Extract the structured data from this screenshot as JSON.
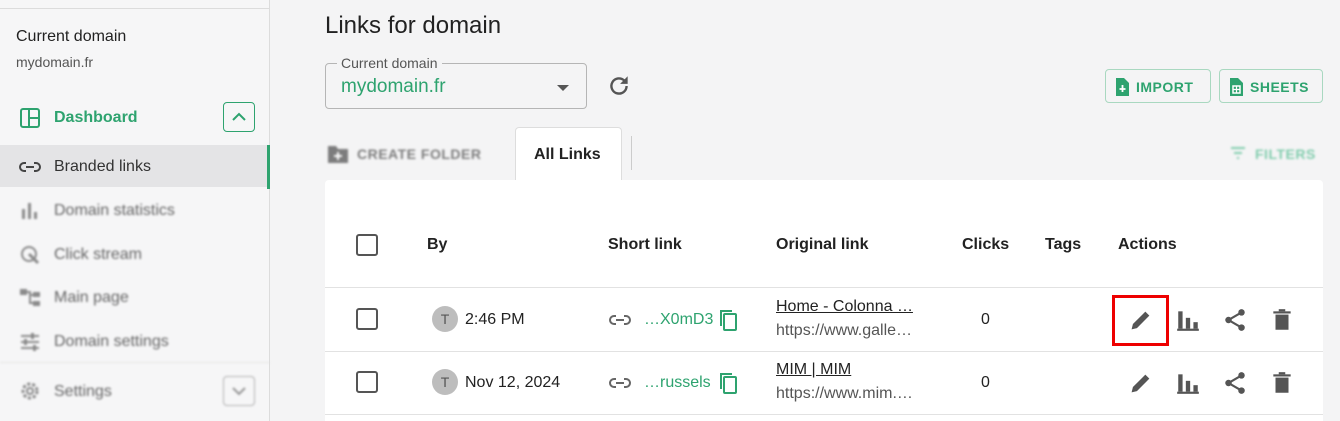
{
  "sidebar": {
    "current_domain_label": "Current domain",
    "current_domain_value": "mydomain.fr",
    "dashboard_label": "Dashboard",
    "items": [
      {
        "label": "Branded links",
        "icon": "link-icon",
        "active": true
      },
      {
        "label": "Domain statistics",
        "icon": "bar-chart-icon",
        "active": false
      },
      {
        "label": "Click stream",
        "icon": "click-stream-icon",
        "active": false
      },
      {
        "label": "Main page",
        "icon": "sitemap-icon",
        "active": false
      },
      {
        "label": "Domain settings",
        "icon": "sliders-icon",
        "active": false
      }
    ],
    "settings_label": "Settings"
  },
  "main": {
    "title": "Links for domain",
    "domain_select": {
      "label": "Current domain",
      "value": "mydomain.fr"
    },
    "import_label": "IMPORT",
    "sheets_label": "SHEETS",
    "create_folder_label": "CREATE FOLDER",
    "tab_all_links": "All Links",
    "filters_label": "FILTERS"
  },
  "table": {
    "headers": {
      "by": "By",
      "short_link": "Short link",
      "original_link": "Original link",
      "clicks": "Clicks",
      "tags": "Tags",
      "actions": "Actions"
    },
    "rows": [
      {
        "avatar": "T",
        "by": "2:46 PM",
        "short_link": "…X0mD3",
        "original_title": "Home - Colonna …",
        "original_url": "https://www.galle…",
        "clicks": "0"
      },
      {
        "avatar": "T",
        "by": "Nov 12, 2024",
        "short_link": "…russels",
        "original_title": "MIM | MIM",
        "original_url": "https://www.mim.…",
        "clicks": "0"
      }
    ]
  },
  "colors": {
    "accent": "#2ea36f",
    "highlight": "#e00000"
  }
}
